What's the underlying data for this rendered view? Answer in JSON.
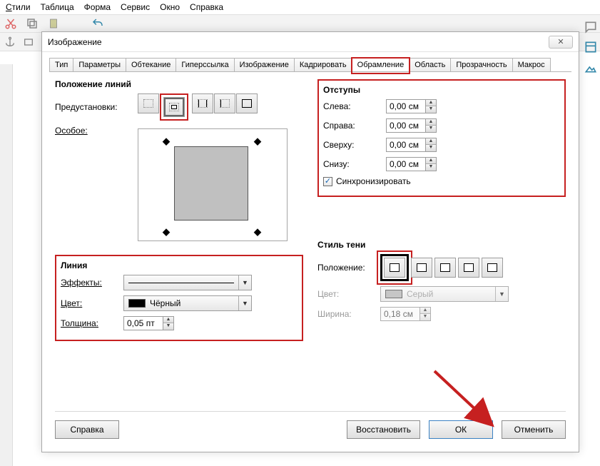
{
  "menu": {
    "styles": "Стили",
    "table": "Таблица",
    "form": "Форма",
    "service": "Сервис",
    "window": "Окно",
    "help": "Справка"
  },
  "dialog": {
    "title": "Изображение",
    "close_glyph": "✕",
    "tabs": {
      "type": "Тип",
      "params": "Параметры",
      "wrap": "Обтекание",
      "hyperlink": "Гиперссылка",
      "image": "Изображение",
      "crop": "Кадрировать",
      "border": "Обрамление",
      "area": "Область",
      "transparency": "Прозрачность",
      "macro": "Макрос"
    },
    "groups": {
      "linepos": "Положение линий",
      "padding": "Отступы",
      "line": "Линия",
      "shadow": "Стиль тени"
    },
    "labels": {
      "presets": "Предустановки:",
      "custom": "Особое:",
      "left": "Слева:",
      "right": "Справа:",
      "top": "Сверху:",
      "bottom": "Снизу:",
      "sync": "Синхронизировать",
      "effects": "Эффекты:",
      "color": "Цвет:",
      "width": "Толщина:",
      "position": "Положение:",
      "shadow_color": "Цвет:",
      "shadow_width": "Ширина:"
    },
    "values": {
      "pad_left": "0,00 см",
      "pad_right": "0,00 см",
      "pad_top": "0,00 см",
      "pad_bottom": "0,00 см",
      "line_color": "Чёрный",
      "line_width": "0,05 пт",
      "shadow_color": "Серый",
      "shadow_width": "0,18 см",
      "sync_checked": true
    },
    "buttons": {
      "help": "Справка",
      "reset": "Восстановить",
      "ok": "ОК",
      "cancel": "Отменить"
    }
  }
}
